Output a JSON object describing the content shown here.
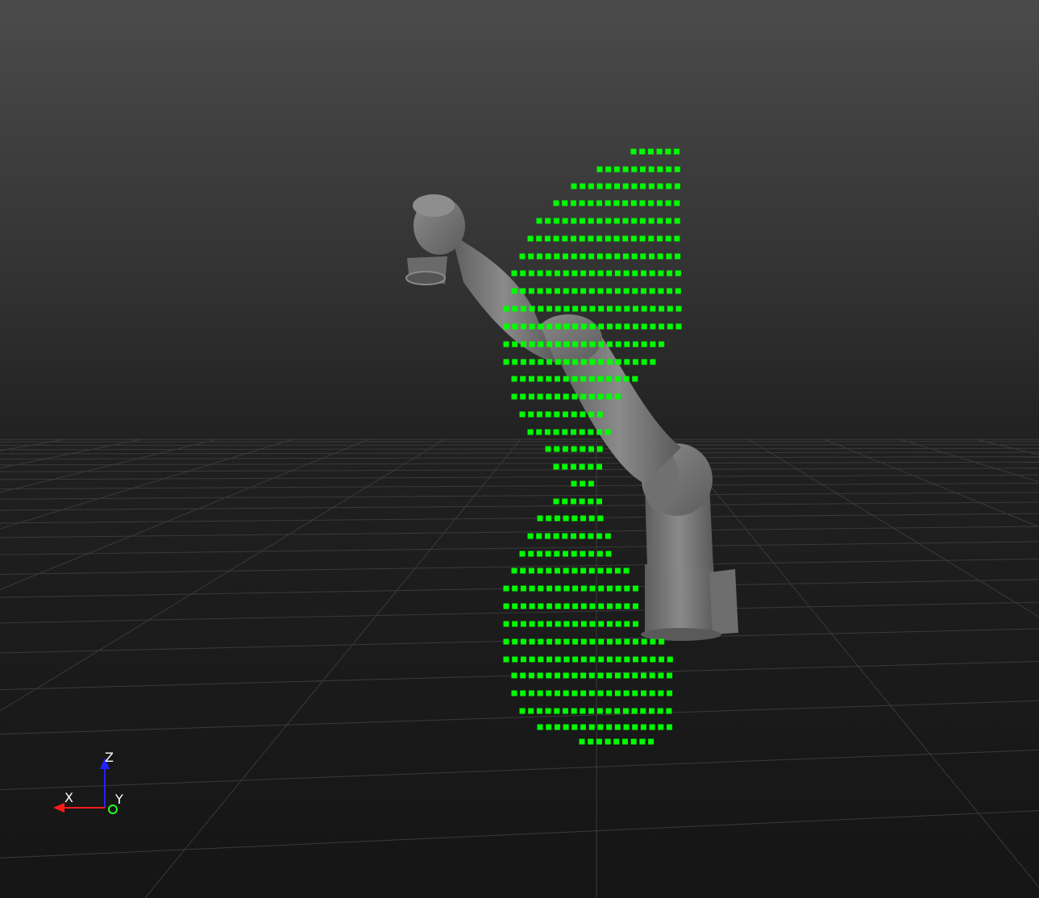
{
  "scene": {
    "view": "3d-viewport",
    "background": {
      "top_color": "#4b4b4b",
      "bottom_color": "#151515"
    },
    "grid": {
      "visible": true,
      "color": "#3a3a3a"
    },
    "robot": {
      "type": "robot-arm",
      "color": "#7a7a7a"
    },
    "point_cloud": {
      "color": "#00ff00",
      "marker": "square"
    }
  },
  "axes_gizmo": {
    "x_label": "X",
    "y_label": "Y",
    "z_label": "Z",
    "x_color": "#ff1a1a",
    "y_color": "#22ff22",
    "z_color": "#2222ff"
  }
}
